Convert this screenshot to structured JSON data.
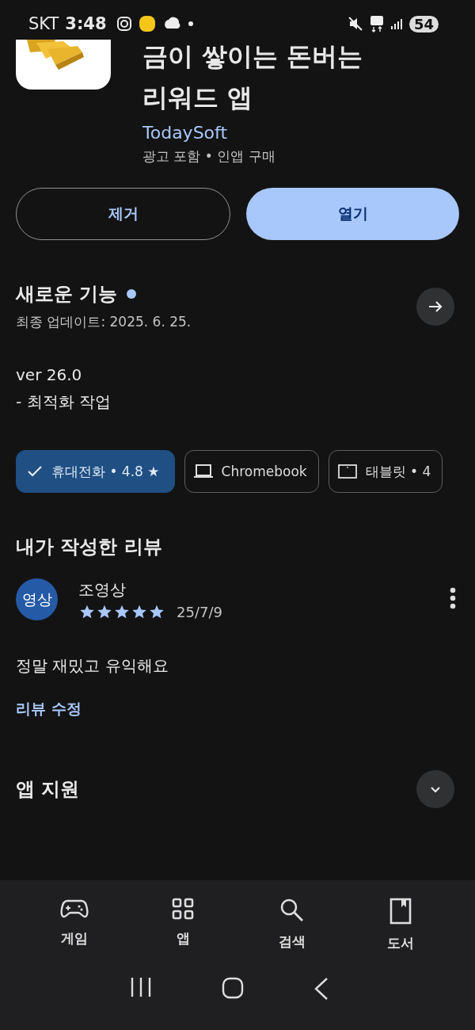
{
  "status_bar": {
    "carrier": "SKT",
    "time": "3:48",
    "battery": "54"
  },
  "app": {
    "title_lines": [
      "금이 쌓이는 돈버는",
      "리워드 앱"
    ],
    "developer": "TodaySoft",
    "meta": "광고 포함 • 인앱 구매"
  },
  "buttons": [
    {
      "label": "제거",
      "kind": "outline"
    },
    {
      "label": "열기",
      "kind": "filled"
    }
  ],
  "whats_new": {
    "title": "새로운 기능",
    "new_dot": true,
    "updated": "최종 업데이트: 2025. 6. 25.",
    "version": "ver 26.0",
    "notes": "- 최적화 작업"
  },
  "devices": [
    {
      "label": "휴대전화 • 4.8 ★",
      "selected": true
    },
    {
      "label": "Chromebook",
      "kind": "laptop",
      "selected": false
    },
    {
      "label": "태블릿 • 4",
      "kind": "tablet",
      "selected": false
    }
  ],
  "my_review": {
    "title": "내가 작성한 리뷰",
    "avatar": "영상",
    "author": "조영상",
    "stars": 5,
    "date": "25/7/9",
    "text": "정말 재밌고 유익해요",
    "edit_link": "리뷰 수정"
  },
  "app_support": {
    "title": "앱 지원",
    "expanded": false
  },
  "bottom_nav": [
    {
      "label": "게임",
      "kind": "games"
    },
    {
      "label": "앱",
      "kind": "apps"
    },
    {
      "label": "검색",
      "kind": "search"
    },
    {
      "label": "도서",
      "kind": "books"
    }
  ]
}
